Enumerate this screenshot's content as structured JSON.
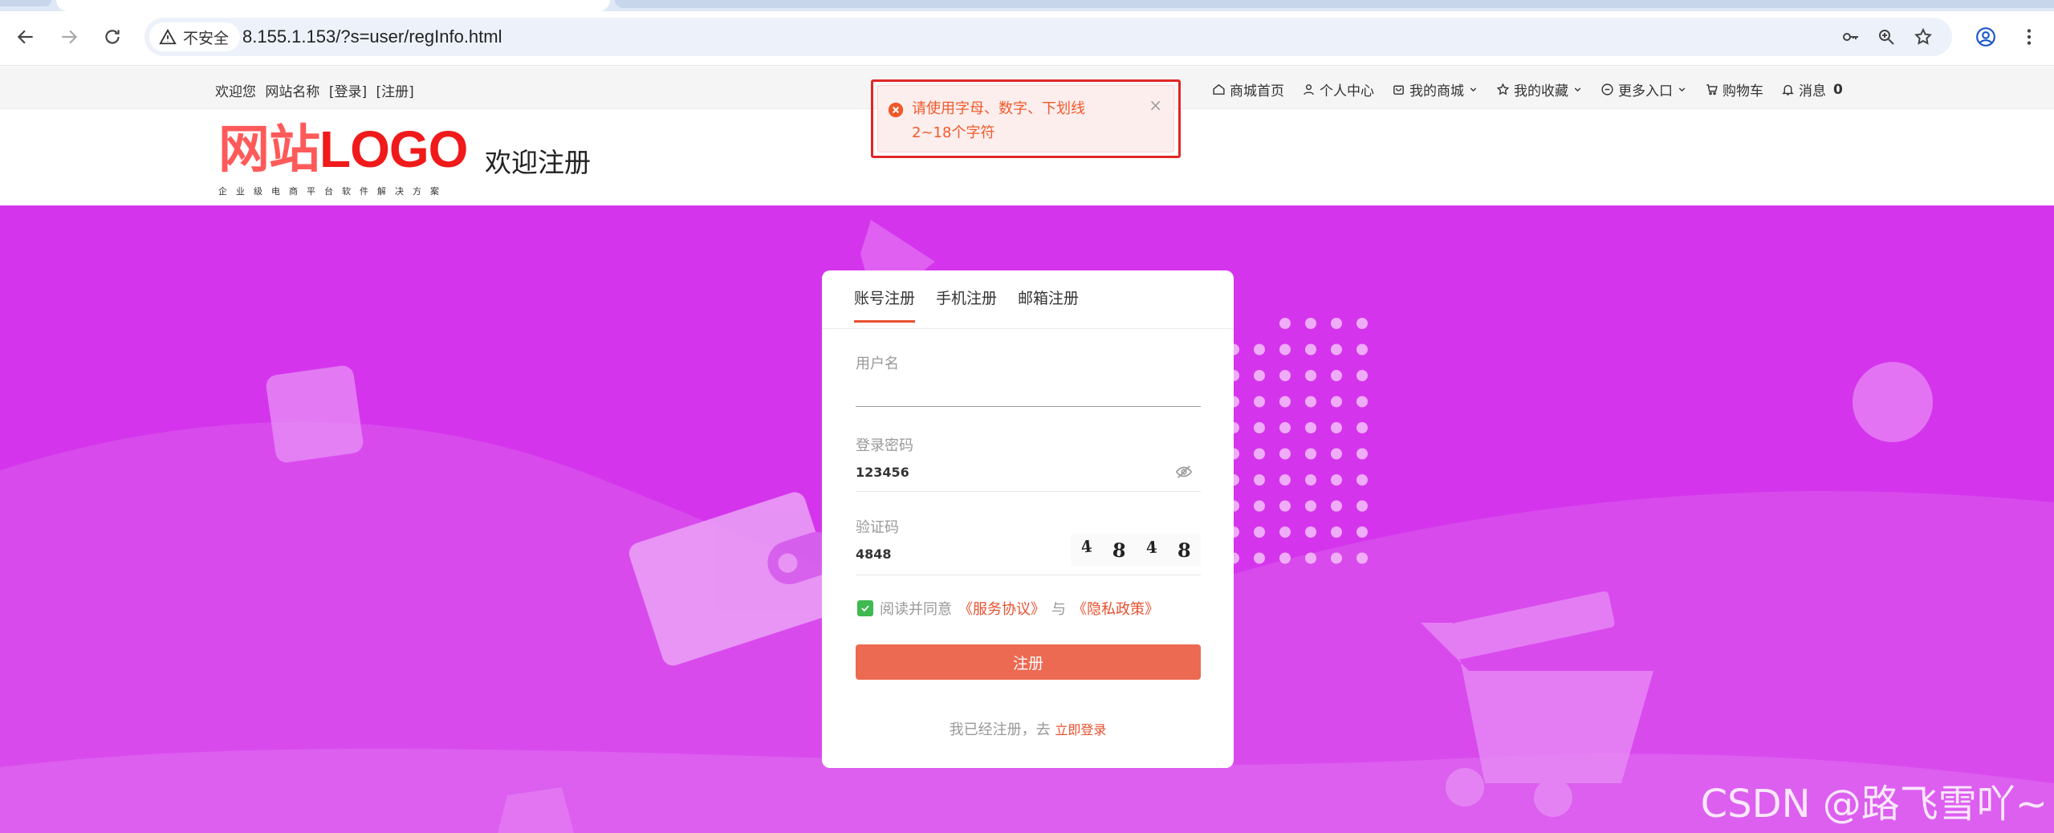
{
  "browser": {
    "security_label": "不安全",
    "url": "8.155.1.153/?s=user/regInfo.html"
  },
  "topbar": {
    "welcome": "欢迎您",
    "site_name": "网站名称",
    "login": "[登录]",
    "register": "[注册]",
    "nav": {
      "home": "商城首页",
      "user_center": "个人中心",
      "my_mall": "我的商城",
      "favorites": "我的收藏",
      "more": "更多入口",
      "cart": "购物车",
      "messages": "消息",
      "message_count": "0"
    }
  },
  "header": {
    "logo_cn": "网站",
    "logo_en": "LOGO",
    "logo_sub": "企业级电商平台软件解决方案",
    "title": "欢迎注册"
  },
  "toast": {
    "message": "请使用字母、数字、下划线2~18个字符",
    "close": "×"
  },
  "form": {
    "tabs": [
      "账号注册",
      "手机注册",
      "邮箱注册"
    ],
    "username_label": "用户名",
    "username_value": "",
    "password_label": "登录密码",
    "password_value": "123456",
    "captcha_label": "验证码",
    "captcha_value": "4848",
    "captcha_chars": [
      "4",
      "8",
      "4",
      "8"
    ],
    "agree_prefix": "阅读并同意",
    "service_link": "《服务协议》",
    "and": "与",
    "privacy_link": "《隐私政策》",
    "submit": "注册",
    "login_prompt": "我已经注册，去",
    "login_link": "立即登录"
  },
  "watermark": "CSDN @路飞雪吖~",
  "colors": {
    "hero_bg": "#d435ec",
    "accent": "#e8502e",
    "button": "#ec6a52",
    "logo_red": "#f01a1a"
  }
}
